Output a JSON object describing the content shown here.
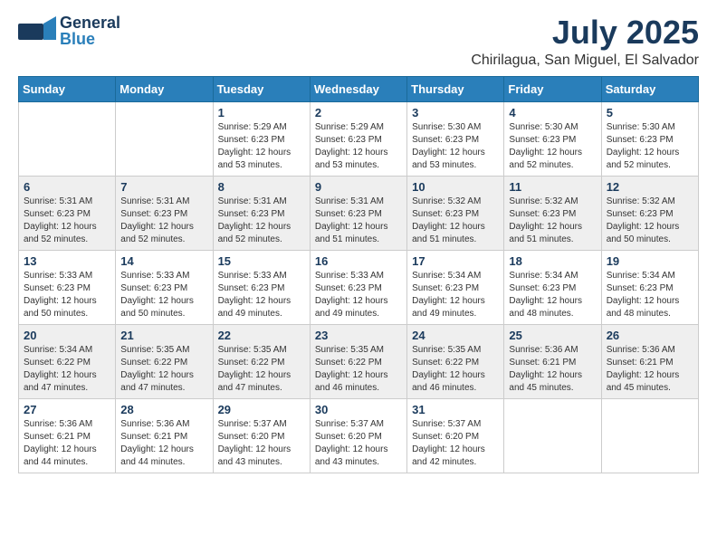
{
  "header": {
    "logo_line1": "General",
    "logo_line2": "Blue",
    "month": "July 2025",
    "location": "Chirilagua, San Miguel, El Salvador"
  },
  "weekdays": [
    "Sunday",
    "Monday",
    "Tuesday",
    "Wednesday",
    "Thursday",
    "Friday",
    "Saturday"
  ],
  "weeks": [
    [
      {
        "day": "",
        "sunrise": "",
        "sunset": "",
        "daylight": ""
      },
      {
        "day": "",
        "sunrise": "",
        "sunset": "",
        "daylight": ""
      },
      {
        "day": "1",
        "sunrise": "Sunrise: 5:29 AM",
        "sunset": "Sunset: 6:23 PM",
        "daylight": "Daylight: 12 hours and 53 minutes."
      },
      {
        "day": "2",
        "sunrise": "Sunrise: 5:29 AM",
        "sunset": "Sunset: 6:23 PM",
        "daylight": "Daylight: 12 hours and 53 minutes."
      },
      {
        "day": "3",
        "sunrise": "Sunrise: 5:30 AM",
        "sunset": "Sunset: 6:23 PM",
        "daylight": "Daylight: 12 hours and 53 minutes."
      },
      {
        "day": "4",
        "sunrise": "Sunrise: 5:30 AM",
        "sunset": "Sunset: 6:23 PM",
        "daylight": "Daylight: 12 hours and 52 minutes."
      },
      {
        "day": "5",
        "sunrise": "Sunrise: 5:30 AM",
        "sunset": "Sunset: 6:23 PM",
        "daylight": "Daylight: 12 hours and 52 minutes."
      }
    ],
    [
      {
        "day": "6",
        "sunrise": "Sunrise: 5:31 AM",
        "sunset": "Sunset: 6:23 PM",
        "daylight": "Daylight: 12 hours and 52 minutes."
      },
      {
        "day": "7",
        "sunrise": "Sunrise: 5:31 AM",
        "sunset": "Sunset: 6:23 PM",
        "daylight": "Daylight: 12 hours and 52 minutes."
      },
      {
        "day": "8",
        "sunrise": "Sunrise: 5:31 AM",
        "sunset": "Sunset: 6:23 PM",
        "daylight": "Daylight: 12 hours and 52 minutes."
      },
      {
        "day": "9",
        "sunrise": "Sunrise: 5:31 AM",
        "sunset": "Sunset: 6:23 PM",
        "daylight": "Daylight: 12 hours and 51 minutes."
      },
      {
        "day": "10",
        "sunrise": "Sunrise: 5:32 AM",
        "sunset": "Sunset: 6:23 PM",
        "daylight": "Daylight: 12 hours and 51 minutes."
      },
      {
        "day": "11",
        "sunrise": "Sunrise: 5:32 AM",
        "sunset": "Sunset: 6:23 PM",
        "daylight": "Daylight: 12 hours and 51 minutes."
      },
      {
        "day": "12",
        "sunrise": "Sunrise: 5:32 AM",
        "sunset": "Sunset: 6:23 PM",
        "daylight": "Daylight: 12 hours and 50 minutes."
      }
    ],
    [
      {
        "day": "13",
        "sunrise": "Sunrise: 5:33 AM",
        "sunset": "Sunset: 6:23 PM",
        "daylight": "Daylight: 12 hours and 50 minutes."
      },
      {
        "day": "14",
        "sunrise": "Sunrise: 5:33 AM",
        "sunset": "Sunset: 6:23 PM",
        "daylight": "Daylight: 12 hours and 50 minutes."
      },
      {
        "day": "15",
        "sunrise": "Sunrise: 5:33 AM",
        "sunset": "Sunset: 6:23 PM",
        "daylight": "Daylight: 12 hours and 49 minutes."
      },
      {
        "day": "16",
        "sunrise": "Sunrise: 5:33 AM",
        "sunset": "Sunset: 6:23 PM",
        "daylight": "Daylight: 12 hours and 49 minutes."
      },
      {
        "day": "17",
        "sunrise": "Sunrise: 5:34 AM",
        "sunset": "Sunset: 6:23 PM",
        "daylight": "Daylight: 12 hours and 49 minutes."
      },
      {
        "day": "18",
        "sunrise": "Sunrise: 5:34 AM",
        "sunset": "Sunset: 6:23 PM",
        "daylight": "Daylight: 12 hours and 48 minutes."
      },
      {
        "day": "19",
        "sunrise": "Sunrise: 5:34 AM",
        "sunset": "Sunset: 6:23 PM",
        "daylight": "Daylight: 12 hours and 48 minutes."
      }
    ],
    [
      {
        "day": "20",
        "sunrise": "Sunrise: 5:34 AM",
        "sunset": "Sunset: 6:22 PM",
        "daylight": "Daylight: 12 hours and 47 minutes."
      },
      {
        "day": "21",
        "sunrise": "Sunrise: 5:35 AM",
        "sunset": "Sunset: 6:22 PM",
        "daylight": "Daylight: 12 hours and 47 minutes."
      },
      {
        "day": "22",
        "sunrise": "Sunrise: 5:35 AM",
        "sunset": "Sunset: 6:22 PM",
        "daylight": "Daylight: 12 hours and 47 minutes."
      },
      {
        "day": "23",
        "sunrise": "Sunrise: 5:35 AM",
        "sunset": "Sunset: 6:22 PM",
        "daylight": "Daylight: 12 hours and 46 minutes."
      },
      {
        "day": "24",
        "sunrise": "Sunrise: 5:35 AM",
        "sunset": "Sunset: 6:22 PM",
        "daylight": "Daylight: 12 hours and 46 minutes."
      },
      {
        "day": "25",
        "sunrise": "Sunrise: 5:36 AM",
        "sunset": "Sunset: 6:21 PM",
        "daylight": "Daylight: 12 hours and 45 minutes."
      },
      {
        "day": "26",
        "sunrise": "Sunrise: 5:36 AM",
        "sunset": "Sunset: 6:21 PM",
        "daylight": "Daylight: 12 hours and 45 minutes."
      }
    ],
    [
      {
        "day": "27",
        "sunrise": "Sunrise: 5:36 AM",
        "sunset": "Sunset: 6:21 PM",
        "daylight": "Daylight: 12 hours and 44 minutes."
      },
      {
        "day": "28",
        "sunrise": "Sunrise: 5:36 AM",
        "sunset": "Sunset: 6:21 PM",
        "daylight": "Daylight: 12 hours and 44 minutes."
      },
      {
        "day": "29",
        "sunrise": "Sunrise: 5:37 AM",
        "sunset": "Sunset: 6:20 PM",
        "daylight": "Daylight: 12 hours and 43 minutes."
      },
      {
        "day": "30",
        "sunrise": "Sunrise: 5:37 AM",
        "sunset": "Sunset: 6:20 PM",
        "daylight": "Daylight: 12 hours and 43 minutes."
      },
      {
        "day": "31",
        "sunrise": "Sunrise: 5:37 AM",
        "sunset": "Sunset: 6:20 PM",
        "daylight": "Daylight: 12 hours and 42 minutes."
      },
      {
        "day": "",
        "sunrise": "",
        "sunset": "",
        "daylight": ""
      },
      {
        "day": "",
        "sunrise": "",
        "sunset": "",
        "daylight": ""
      }
    ]
  ]
}
